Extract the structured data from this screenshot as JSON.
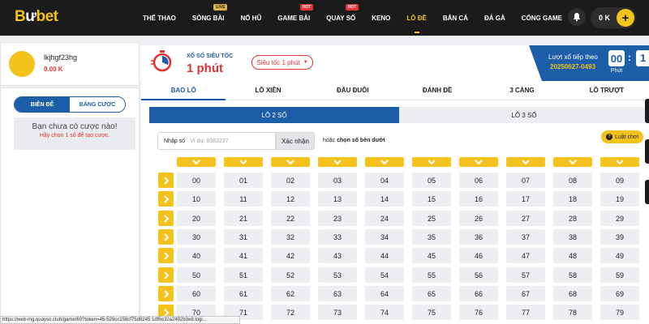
{
  "logo": {
    "yellow": "B",
    "white": "ư",
    "rest": "bet"
  },
  "nav": [
    {
      "label": "THỂ THAO",
      "badge": ""
    },
    {
      "label": "SÒNG BÀI",
      "badge": "LIVE"
    },
    {
      "label": "NỔ HŨ",
      "badge": ""
    },
    {
      "label": "GAME BÀI",
      "badge": "HOT"
    },
    {
      "label": "QUAY SỐ",
      "badge": "HOT"
    },
    {
      "label": "KENO",
      "badge": ""
    },
    {
      "label": "LÔ ĐỀ",
      "badge": ""
    },
    {
      "label": "BẮN CÁ",
      "badge": ""
    },
    {
      "label": "ĐÁ GÀ",
      "badge": ""
    },
    {
      "label": "CỔNG GAME",
      "badge": ""
    }
  ],
  "nav_active_index": 6,
  "header": {
    "balance": "0 K",
    "plus": "+"
  },
  "user": {
    "name": "lkjhgf23hg",
    "balance": "0.00 K"
  },
  "ticket": {
    "tabs": [
      "BIÊN ĐỂ",
      "BẢNG CƯỢC"
    ],
    "empty_title": "Bạn chưa có cược nào!",
    "empty_sub": "Hãy chọn 1 số để tạo cược."
  },
  "game": {
    "subtitle": "XỔ SỐ SIÊU TỐC",
    "title": "1 phút",
    "speed_select": "Siêu tốc 1 phút",
    "next_label": "Lượt xổ tiếp theo",
    "next_id": "20250627-0493",
    "countdown_minutes": "00",
    "countdown_minutes_label": "Phút",
    "countdown_colon": ":",
    "countdown_seconds_partial": "1"
  },
  "tabs": [
    "BAO LÔ",
    "LÔ XIÊN",
    "ĐẦU ĐUÔI",
    "ĐÁNH ĐỀ",
    "3 CÀNG",
    "LÔ TRƯỢT"
  ],
  "active_tab": 0,
  "subtabs": [
    "LÔ 2 SỐ",
    "LÔ 3 SỐ"
  ],
  "entry": {
    "label": "Nhập số",
    "placeholder": "Ví dụ: 8383237",
    "button": "Xác nhận",
    "or_text": "hoặc",
    "or_bold": "chọn số bên dưới"
  },
  "rules_label": "Luật chơi",
  "numbers": [
    [
      "00",
      "01",
      "02",
      "03",
      "04",
      "05",
      "06",
      "07",
      "08",
      "09"
    ],
    [
      "10",
      "11",
      "12",
      "13",
      "14",
      "15",
      "16",
      "17",
      "18",
      "19"
    ],
    [
      "20",
      "21",
      "22",
      "23",
      "24",
      "25",
      "26",
      "27",
      "28",
      "29"
    ],
    [
      "30",
      "31",
      "32",
      "33",
      "34",
      "35",
      "36",
      "37",
      "38",
      "39"
    ],
    [
      "40",
      "41",
      "42",
      "43",
      "44",
      "45",
      "46",
      "47",
      "48",
      "49"
    ],
    [
      "50",
      "51",
      "52",
      "53",
      "54",
      "55",
      "56",
      "57",
      "58",
      "59"
    ],
    [
      "60",
      "61",
      "62",
      "63",
      "64",
      "65",
      "66",
      "67",
      "68",
      "69"
    ],
    [
      "70",
      "71",
      "72",
      "73",
      "74",
      "75",
      "76",
      "77",
      "78",
      "79"
    ]
  ],
  "status_url": "https://web-mg.quayso.club/game/60?token=45-529cc158cf75d8245 1df6e32a2492b3e8.logi...",
  "colors": {
    "yellow": "#f3c21b",
    "blue": "#1c5fa8",
    "red": "#e0322f",
    "dark": "#1b1b1b"
  }
}
